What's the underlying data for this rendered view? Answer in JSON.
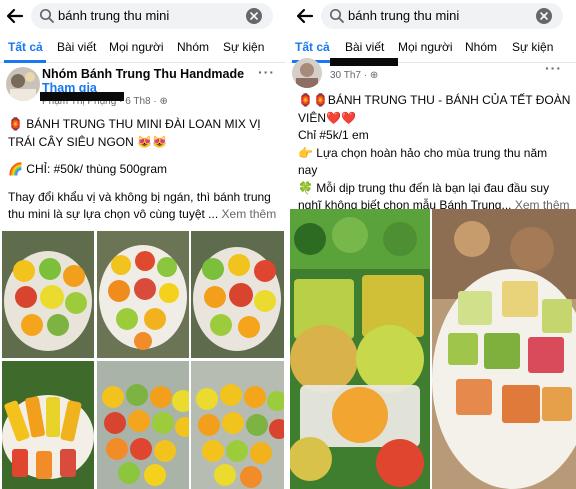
{
  "left": {
    "search_query": "bánh trung thu mini",
    "tabs": [
      "Tất cả",
      "Bài viết",
      "Mọi người",
      "Nhóm",
      "Sự kiện"
    ],
    "group_name": "Nhóm Bánh Trung Thu Handmade",
    "join_label": "Tham gia",
    "author": "Phạm Thị Phụng",
    "date": "6 Th8",
    "more": "···",
    "lines": [
      "🏮 BÁNH TRUNG THU MINI ĐÀI LOAN MIX VỊ",
      "TRÁI CÂY SIÊU NGON 😻😻",
      "",
      "🌈 CHỈ: #50k/ thùng 500gram",
      "",
      "Thay đổi khẩu vị và không bị ngán, thì bánh trung",
      "thu mini là sự lựa chọn vô cùng tuyệt ..."
    ],
    "see_more": "Xem thêm"
  },
  "right": {
    "search_query": "bánh trung thu mini",
    "tabs": [
      "Tất cả",
      "Bài viết",
      "Mọi người",
      "Nhóm",
      "Sự kiện"
    ],
    "date": "30 Th7",
    "more": "···",
    "title_line1": "🏮🏮BÁNH TRUNG THU  - BÁNH CỦA TẾT ĐOÀN",
    "title_line2": "VIÊN❤️❤️",
    "price": "Chỉ #5k/1 em",
    "line3": "👉 Lựa chọn hoàn hảo cho mùa trung thu năm",
    "line4": "nay",
    "line5": "🍀 Mỗi dịp trung thu đến là bạn lại đau đầu suy",
    "line6": "nghĩ không biết chọn mẫu Bánh Trung...",
    "see_more": "Xem thêm"
  },
  "colors": {
    "accent": "#1877f2",
    "search_bg": "#f0f2f5",
    "muted": "#65676b"
  }
}
